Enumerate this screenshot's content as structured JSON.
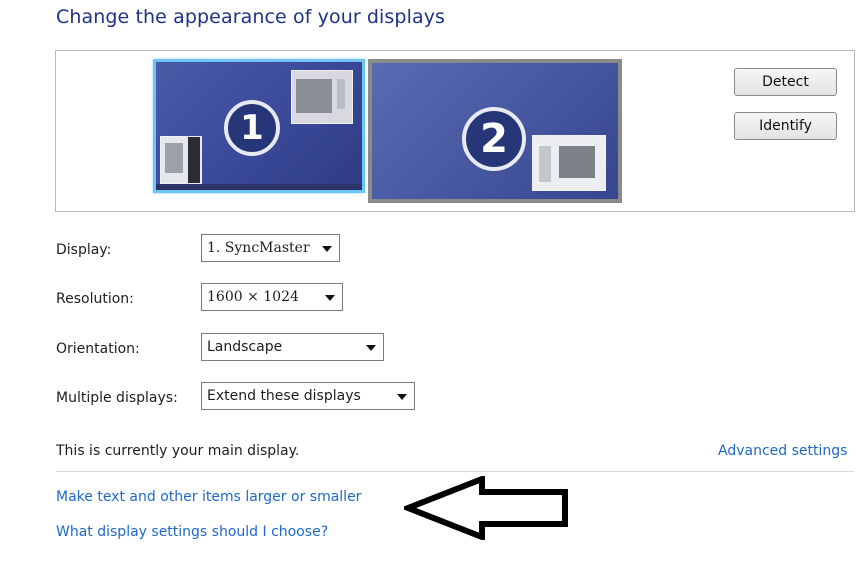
{
  "page": {
    "title": "Change the appearance of your displays"
  },
  "monitors": [
    {
      "number": "1"
    },
    {
      "number": "2"
    }
  ],
  "buttons": {
    "detect": "Detect",
    "identify": "Identify"
  },
  "settings": {
    "display": {
      "label": "Display:",
      "value": "1. SyncMaster"
    },
    "resolution": {
      "label": "Resolution:",
      "value": "1600 × 1024"
    },
    "orientation": {
      "label": "Orientation:",
      "value": "Landscape"
    },
    "multiple": {
      "label": "Multiple displays:",
      "value": "Extend these displays"
    }
  },
  "status": {
    "main_display": "This is currently your main display.",
    "advanced": "Advanced settings"
  },
  "links": {
    "text_size": "Make text and other items larger or smaller",
    "help": "What display settings should I choose?"
  },
  "annotation": {
    "arrow_icon": "left-arrow-icon",
    "color": "#000000"
  },
  "colors": {
    "link": "#1e69c8",
    "title": "#1e3287",
    "selection": "#6fc4f3"
  }
}
